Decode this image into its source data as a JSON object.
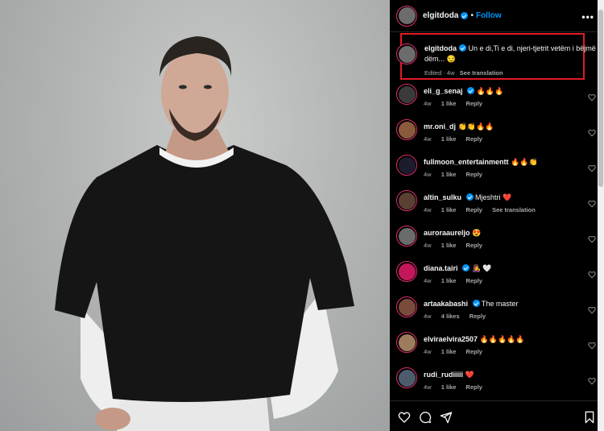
{
  "post": {
    "username": "elgitdoda",
    "follow_label": "Follow",
    "separator": "•",
    "more_label": "•••"
  },
  "caption": {
    "username": "elgitdoda",
    "text": "Un e di,Ti e di, njeri-tjetrit vetëm i bëjmë dëm... 😏",
    "edited": "Edited · 4w",
    "see_translation": "See translation"
  },
  "comments": [
    {
      "username": "eli_g_senaj",
      "verified": true,
      "text": "🔥🔥🔥",
      "age": "4w",
      "likes": "1 like",
      "reply": "Reply",
      "see_translation": "",
      "avatar_color": "#3a3a3a"
    },
    {
      "username": "mr.oni_dj",
      "verified": false,
      "text": "👏👏🔥🔥",
      "age": "4w",
      "likes": "1 like",
      "reply": "Reply",
      "see_translation": "",
      "avatar_color": "#8a5a3c"
    },
    {
      "username": "fullmoon_entertainmentt",
      "verified": false,
      "text": "🔥🔥👏",
      "age": "4w",
      "likes": "1 like",
      "reply": "Reply",
      "see_translation": "",
      "avatar_color": "#1c1c2e"
    },
    {
      "username": "altin_sulku",
      "verified": true,
      "text": "Mjeshtri ❤️",
      "age": "4w",
      "likes": "1 like",
      "reply": "Reply",
      "see_translation": "See translation",
      "avatar_color": "#5a4032"
    },
    {
      "username": "auroraaureljo",
      "verified": false,
      "text": "😍",
      "age": "4w",
      "likes": "1 like",
      "reply": "Reply",
      "see_translation": "",
      "avatar_color": "#6b6b6b"
    },
    {
      "username": "diana.tairi",
      "verified": true,
      "text": "👩‍🎤 🤍",
      "age": "4w",
      "likes": "1 like",
      "reply": "Reply",
      "see_translation": "",
      "avatar_color": "#c2185b"
    },
    {
      "username": "artaakabashi",
      "verified": true,
      "text": "The master",
      "age": "4w",
      "likes": "4 likes",
      "reply": "Reply",
      "see_translation": "",
      "avatar_color": "#7a4b3a"
    },
    {
      "username": "elviraelvira2507",
      "verified": false,
      "text": "🔥🔥🔥🔥🔥",
      "age": "4w",
      "likes": "1 like",
      "reply": "Reply",
      "see_translation": "",
      "avatar_color": "#9c7c5c"
    },
    {
      "username": "rudi_rudiiiii",
      "verified": false,
      "text": "❤️",
      "age": "4w",
      "likes": "1 like",
      "reply": "Reply",
      "see_translation": "",
      "avatar_color": "#4c5c6c"
    }
  ],
  "icons": {
    "like": "heart-icon",
    "comment": "comment-icon",
    "share": "share-icon",
    "save": "bookmark-icon"
  },
  "colors": {
    "accent": "#0095f6",
    "highlight_box": "#e01b24",
    "story_ring": "#e1306c",
    "background": "#000000"
  }
}
